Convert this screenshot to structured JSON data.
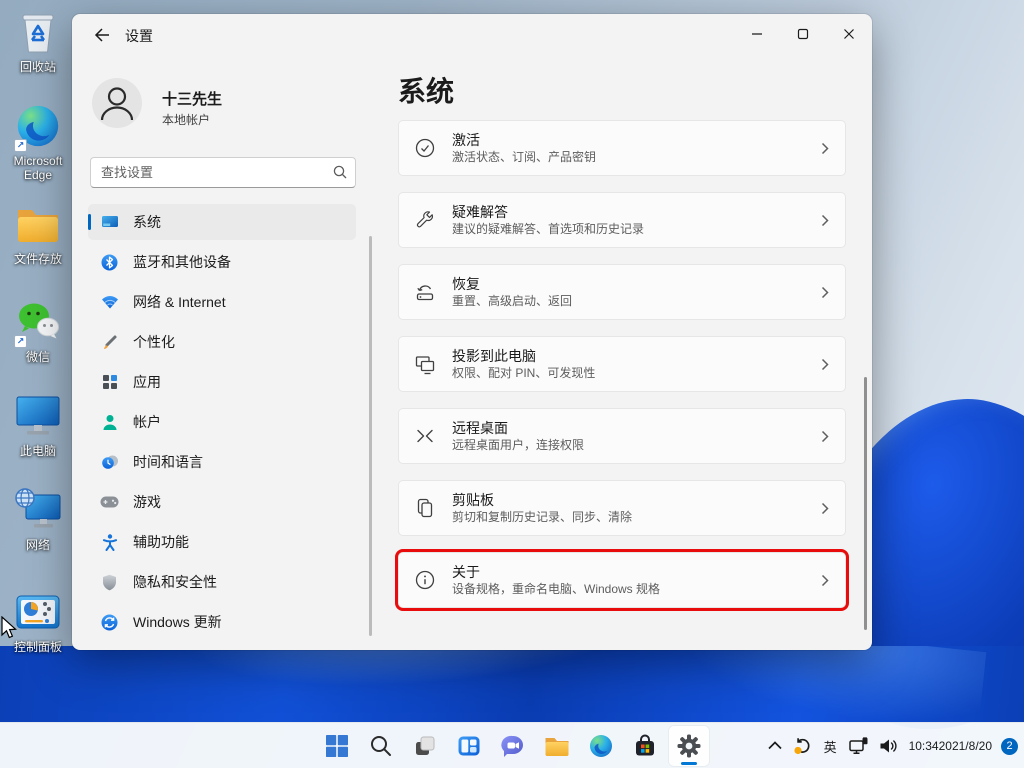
{
  "desktop": {
    "icons": [
      {
        "label": "回收站",
        "icon": "recycle-bin-icon"
      },
      {
        "label": "Microsoft Edge",
        "icon": "edge-icon"
      },
      {
        "label": "文件存放",
        "icon": "folder-icon"
      },
      {
        "label": "微信",
        "icon": "wechat-icon"
      },
      {
        "label": "此电脑",
        "icon": "this-pc-icon"
      },
      {
        "label": "网络",
        "icon": "network-icon"
      },
      {
        "label": "控制面板",
        "icon": "control-panel-icon"
      }
    ]
  },
  "settings": {
    "title": "设置",
    "user": {
      "name": "十三先生",
      "type": "本地帐户"
    },
    "search_placeholder": "查找设置",
    "nav": [
      {
        "label": "系统",
        "icon": "system-icon",
        "selected": true
      },
      {
        "label": "蓝牙和其他设备",
        "icon": "bluetooth-icon"
      },
      {
        "label": "网络 & Internet",
        "icon": "wifi-icon"
      },
      {
        "label": "个性化",
        "icon": "personalization-icon"
      },
      {
        "label": "应用",
        "icon": "apps-icon"
      },
      {
        "label": "帐户",
        "icon": "accounts-icon"
      },
      {
        "label": "时间和语言",
        "icon": "time-language-icon"
      },
      {
        "label": "游戏",
        "icon": "gaming-icon"
      },
      {
        "label": "辅助功能",
        "icon": "accessibility-icon"
      },
      {
        "label": "隐私和安全性",
        "icon": "privacy-icon"
      },
      {
        "label": "Windows 更新",
        "icon": "windows-update-icon"
      }
    ],
    "heading": "系统",
    "cards": [
      {
        "title": "激活",
        "subtitle": "激活状态、订阅、产品密钥",
        "icon": "activation-icon"
      },
      {
        "title": "疑难解答",
        "subtitle": "建议的疑难解答、首选项和历史记录",
        "icon": "troubleshoot-icon"
      },
      {
        "title": "恢复",
        "subtitle": "重置、高级启动、返回",
        "icon": "recovery-icon"
      },
      {
        "title": "投影到此电脑",
        "subtitle": "权限、配对 PIN、可发现性",
        "icon": "project-icon"
      },
      {
        "title": "远程桌面",
        "subtitle": "远程桌面用户，连接权限",
        "icon": "remote-desktop-icon"
      },
      {
        "title": "剪贴板",
        "subtitle": "剪切和复制历史记录、同步、清除",
        "icon": "clipboard-icon"
      },
      {
        "title": "关于",
        "subtitle": "设备规格，重命名电脑、Windows 规格",
        "icon": "about-icon",
        "highlighted": true
      }
    ],
    "colors": {
      "accent": "#0067c0",
      "highlight_red": "#e80c0c"
    }
  },
  "taskbar": {
    "buttons": [
      {
        "name": "start",
        "icon": "windows-start-icon"
      },
      {
        "name": "search",
        "icon": "search-icon"
      },
      {
        "name": "task-view",
        "icon": "task-view-icon"
      },
      {
        "name": "widgets",
        "icon": "widgets-icon"
      },
      {
        "name": "chat",
        "icon": "chat-icon"
      },
      {
        "name": "file-explorer",
        "icon": "file-explorer-icon"
      },
      {
        "name": "edge",
        "icon": "edge-icon"
      },
      {
        "name": "store",
        "icon": "store-icon"
      },
      {
        "name": "settings",
        "icon": "gear-icon",
        "active": true
      }
    ]
  },
  "tray": {
    "language": "英",
    "time": "10:34",
    "date": "2021/8/20",
    "badge": "2",
    "badge_color": "#0067c0"
  }
}
